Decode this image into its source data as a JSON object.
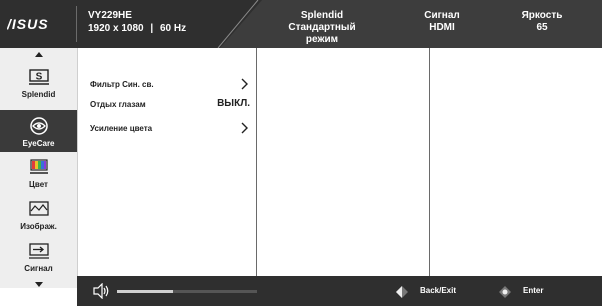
{
  "header": {
    "brand": "ASUS",
    "model": "VY229HE",
    "resolution": "1920 x 1080",
    "refresh": "60 Hz",
    "splendid_title": "Splendid",
    "splendid_value": "Стандартный режим",
    "signal_title": "Сигнал",
    "signal_value": "HDMI",
    "brightness_title": "Яркость",
    "brightness_value": "65"
  },
  "sidebar": {
    "up_icon": "triangle-up-icon",
    "down_icon": "triangle-down-icon",
    "items": [
      {
        "label": "Splendid",
        "icon": "splendid-s-icon",
        "active": false
      },
      {
        "label": "EyeCare",
        "icon": "eye-icon",
        "active": true
      },
      {
        "label": "Цвет",
        "icon": "color-bars-icon",
        "active": false
      },
      {
        "label": "Изображ.",
        "icon": "image-wave-icon",
        "active": false
      },
      {
        "label": "Сигнал",
        "icon": "input-arrow-icon",
        "active": false
      }
    ]
  },
  "menu": {
    "items": [
      {
        "label": "Фильтр Син. св.",
        "value": "",
        "submenu": true
      },
      {
        "label": "Отдых глазам",
        "value": "ВЫКЛ.",
        "submenu": false
      },
      {
        "label": "Усиление цвета",
        "value": "",
        "submenu": true
      }
    ]
  },
  "footer": {
    "volume_icon": "speaker-icon",
    "volume_level_pct": 40,
    "back_label": "Back/Exit",
    "enter_label": "Enter"
  },
  "colors": {
    "header_bg": "#2f2f2f",
    "sidebar_bg": "#eeeeee",
    "active_bg": "#3a3a3a"
  }
}
